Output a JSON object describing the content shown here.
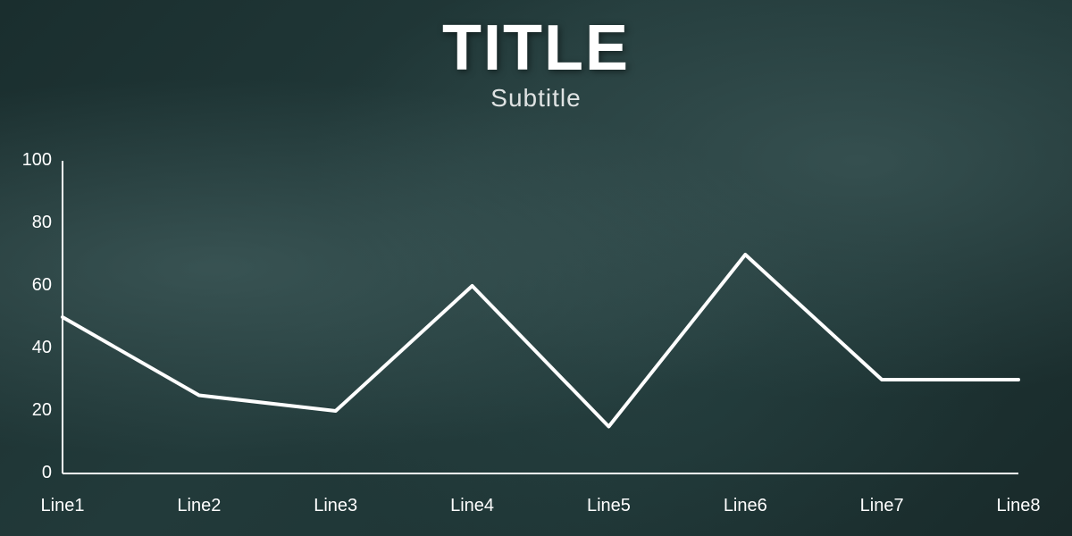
{
  "title": "TITLE",
  "subtitle": "Subtitle",
  "chart": {
    "y_axis_labels": [
      "0",
      "20",
      "40",
      "60",
      "80",
      "100"
    ],
    "x_axis_labels": [
      "Line1",
      "Line2",
      "Line3",
      "Line4",
      "Line5",
      "Line6",
      "Line7",
      "Line8"
    ],
    "data_points": [
      {
        "label": "Line1",
        "value": 50
      },
      {
        "label": "Line2",
        "value": 25
      },
      {
        "label": "Line3",
        "value": 20
      },
      {
        "label": "Line4",
        "value": 60
      },
      {
        "label": "Line5",
        "value": 15
      },
      {
        "label": "Line6",
        "value": 70
      },
      {
        "label": "Line7",
        "value": 30
      },
      {
        "label": "Line8",
        "value": 30
      }
    ],
    "y_min": 0,
    "y_max": 100,
    "line_color": "#ffffff",
    "line_width": 4,
    "axis_color": "#ffffff"
  }
}
